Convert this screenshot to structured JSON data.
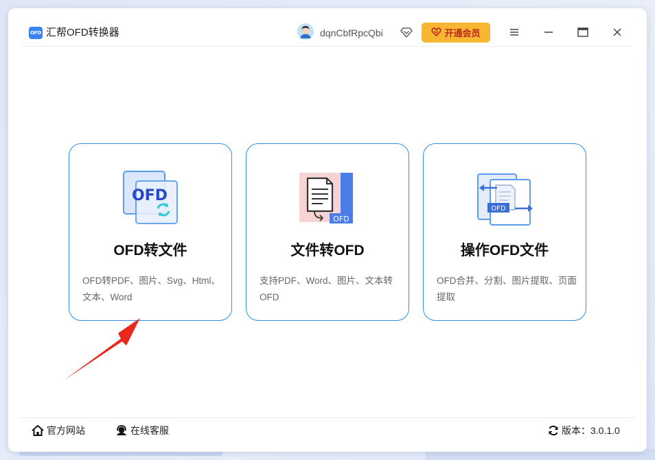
{
  "app": {
    "title": "汇帮OFD转换器",
    "logo_text": "OFD"
  },
  "header": {
    "username": "dqnCbfRpcQbi",
    "vip_label": "开通会员",
    "colors": {
      "vip_bg": "#f7b733",
      "vip_text": "#c0271f",
      "accent": "#2e8fe8"
    }
  },
  "cards": [
    {
      "title": "OFD转文件",
      "desc": "OFD转PDF、图片、Svg、Html、文本、Word",
      "icon": "ofd-to-file-icon",
      "icon_text": "OFD"
    },
    {
      "title": "文件转OFD",
      "desc": "支持PDF、Word、图片、文本转OFD",
      "icon": "file-to-ofd-icon",
      "icon_text": "OFD"
    },
    {
      "title": "操作OFD文件",
      "desc": "OFD合并、分割、图片提取、页面提取",
      "icon": "ofd-operate-icon",
      "icon_text": "OFD"
    }
  ],
  "footer": {
    "website": "官方网站",
    "support": "在线客服",
    "version_label": "版本：3.0.1.0"
  }
}
